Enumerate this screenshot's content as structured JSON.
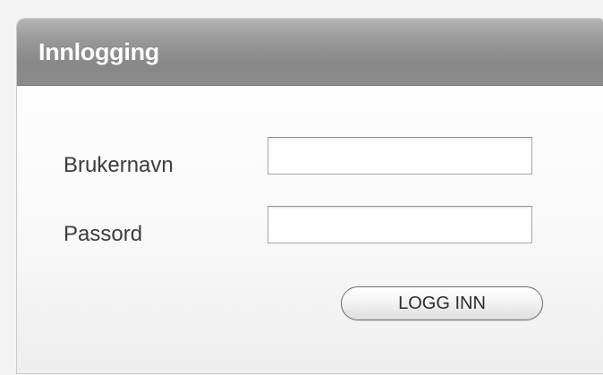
{
  "login_panel": {
    "title": "Innlogging",
    "username_label": "Brukernavn",
    "username_value": "",
    "password_label": "Passord",
    "password_value": "",
    "submit_label": "LOGG INN"
  }
}
